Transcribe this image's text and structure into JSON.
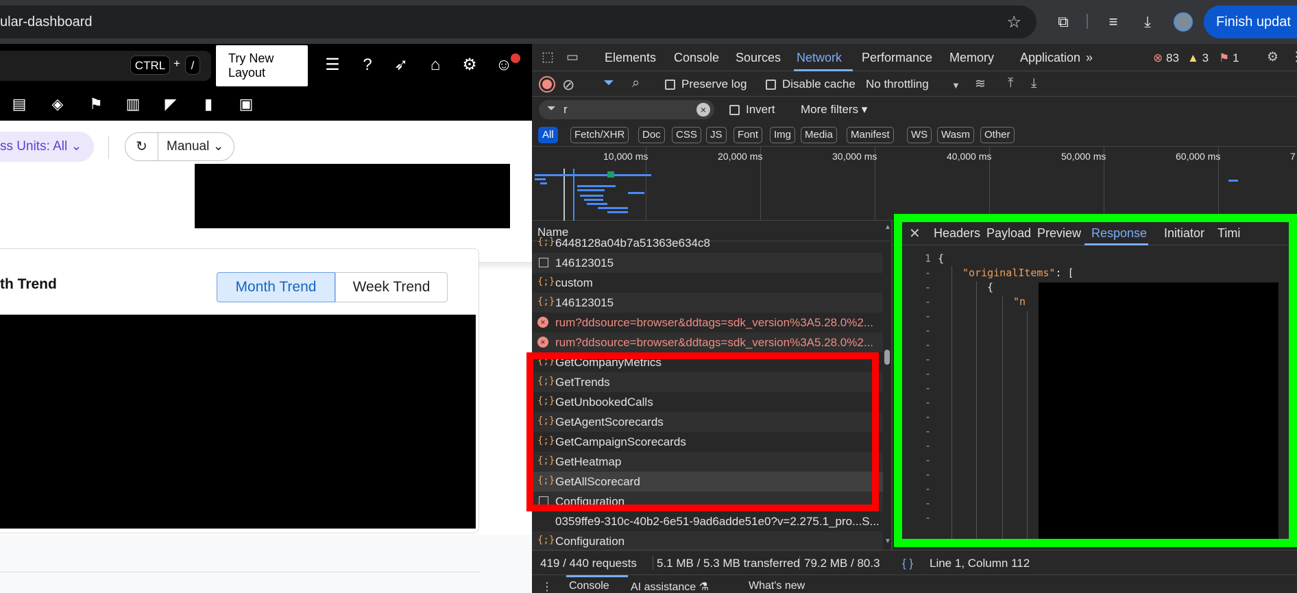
{
  "browser": {
    "url": "ular-dashboard",
    "finish_update": "Finish updat"
  },
  "app": {
    "kbd_ctrl": "CTRL",
    "kbd_plus": "+",
    "kbd_slash": "/",
    "try_new_layout": "Try New Layout",
    "units_filter": "ss Units: All",
    "manual_label": "Manual",
    "card_title": "th Trend",
    "segments": {
      "month": "Month Trend",
      "week": "Week Trend"
    }
  },
  "devtools": {
    "tabs": [
      "Elements",
      "Console",
      "Sources",
      "Network",
      "Performance",
      "Memory",
      "Application"
    ],
    "active_tab": "Network",
    "error_count": "83",
    "warning_count": "3",
    "issue_count": "1",
    "preserve_log": "Preserve log",
    "disable_cache": "Disable cache",
    "throttling": "No throttling",
    "filter_value": "r",
    "invert": "Invert",
    "more_filters": "More filters",
    "type_filters": [
      "All",
      "Fetch/XHR",
      "Doc",
      "CSS",
      "JS",
      "Font",
      "Img",
      "Media",
      "Manifest",
      "WS",
      "Wasm",
      "Other"
    ],
    "timeline_ticks": [
      "10,000 ms",
      "20,000 ms",
      "30,000 ms",
      "40,000 ms",
      "50,000 ms",
      "60,000 ms",
      "7"
    ],
    "name_header": "Name",
    "requests": [
      {
        "name": "6448128a04b7a51363e634c8",
        "kind": "xhr"
      },
      {
        "name": "146123015",
        "kind": "doc"
      },
      {
        "name": "custom",
        "kind": "xhr"
      },
      {
        "name": "146123015",
        "kind": "xhr"
      },
      {
        "name": "rum?ddsource=browser&ddtags=sdk_version%3A5.28.0%2...",
        "kind": "error"
      },
      {
        "name": "rum?ddsource=browser&ddtags=sdk_version%3A5.28.0%2...",
        "kind": "error"
      },
      {
        "name": "GetCompanyMetrics",
        "kind": "xhr"
      },
      {
        "name": "GetTrends",
        "kind": "xhr"
      },
      {
        "name": "GetUnbookedCalls",
        "kind": "xhr"
      },
      {
        "name": "GetAgentScorecards",
        "kind": "xhr"
      },
      {
        "name": "GetCampaignScorecards",
        "kind": "xhr"
      },
      {
        "name": "GetHeatmap",
        "kind": "xhr"
      },
      {
        "name": "GetAllScorecard",
        "kind": "xhr"
      },
      {
        "name": "Configuration",
        "kind": "doc"
      },
      {
        "name": "0359ffe9-310c-40b2-6e51-9ad6adde51e0?v=2.275.1_pro...S...",
        "kind": "none"
      },
      {
        "name": "Configuration",
        "kind": "xhr"
      }
    ],
    "detail_tabs": [
      "Headers",
      "Payload",
      "Preview",
      "Response",
      "Initiator",
      "Timi"
    ],
    "active_detail_tab": "Response",
    "response_line_1": "1",
    "response_brace": "{",
    "response_key": "\"originalItems\"",
    "response_colon_bracket": ": [",
    "response_inner_brace": "{",
    "response_partial": "\"n",
    "status": {
      "requests": "419 / 440 requests",
      "transferred": "5.1 MB / 5.3 MB transferred",
      "resources": "79.2 MB / 80.3",
      "cursor": "Line 1, Column 112"
    },
    "drawer": {
      "console": "Console",
      "ai": "AI assistance",
      "whats_new": "What's new"
    }
  }
}
